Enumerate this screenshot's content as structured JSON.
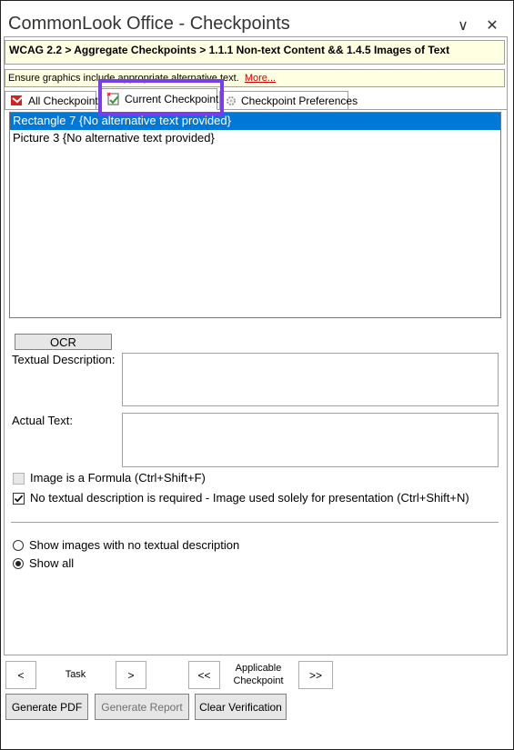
{
  "window": {
    "title": "CommonLook Office - Checkpoints",
    "dropdown_glyph": "∨",
    "close_glyph": "✕"
  },
  "breadcrumb": "WCAG 2.2 > Aggregate Checkpoints > 1.1.1 Non-text Content && 1.4.5 Images of Text",
  "info": {
    "text": "Ensure graphics include appropriate alternative text.",
    "more_link": "More..."
  },
  "tabs": [
    {
      "label": "All Checkpoints",
      "icon": "all-checkpoints-icon",
      "active": false
    },
    {
      "label": "Current Checkpoint",
      "icon": "current-checkpoint-icon",
      "active": true
    },
    {
      "label": "Checkpoint Preferences",
      "icon": "gear-icon",
      "active": false
    }
  ],
  "list": {
    "items": [
      {
        "text": "Rectangle 7 {No alternative text provided}",
        "selected": true
      },
      {
        "text": "Picture 3 {No alternative text provided}",
        "selected": false
      }
    ]
  },
  "form": {
    "ocr_button": "OCR",
    "textual_description_label": "Textual Description:",
    "textual_description_value": "",
    "actual_text_label": "Actual Text:",
    "actual_text_value": "",
    "formula_checkbox": {
      "label": "Image is a Formula (Ctrl+Shift+F)",
      "checked": false,
      "enabled": false
    },
    "no_description_checkbox": {
      "label": "No textual description is required - Image used solely for presentation (Ctrl+Shift+N)",
      "checked": true,
      "enabled": true
    }
  },
  "filter": {
    "options": [
      {
        "label": "Show images with no textual description",
        "selected": false
      },
      {
        "label": "Show all",
        "selected": true
      }
    ]
  },
  "nav": {
    "task_prev": "<",
    "task_label": "Task",
    "task_next": ">",
    "checkpoint_prev": "<<",
    "checkpoint_label_line1": "Applicable",
    "checkpoint_label_line2": "Checkpoint",
    "checkpoint_next": ">>"
  },
  "actions": {
    "generate_pdf": "Generate PDF",
    "generate_report": "Generate Report",
    "clear_verification": "Clear Verification"
  },
  "colors": {
    "selection": "#0078d7",
    "highlight_frame": "#7a3cf0",
    "tooltip_bg": "#ffffe1",
    "more_link": "#cc0000"
  }
}
